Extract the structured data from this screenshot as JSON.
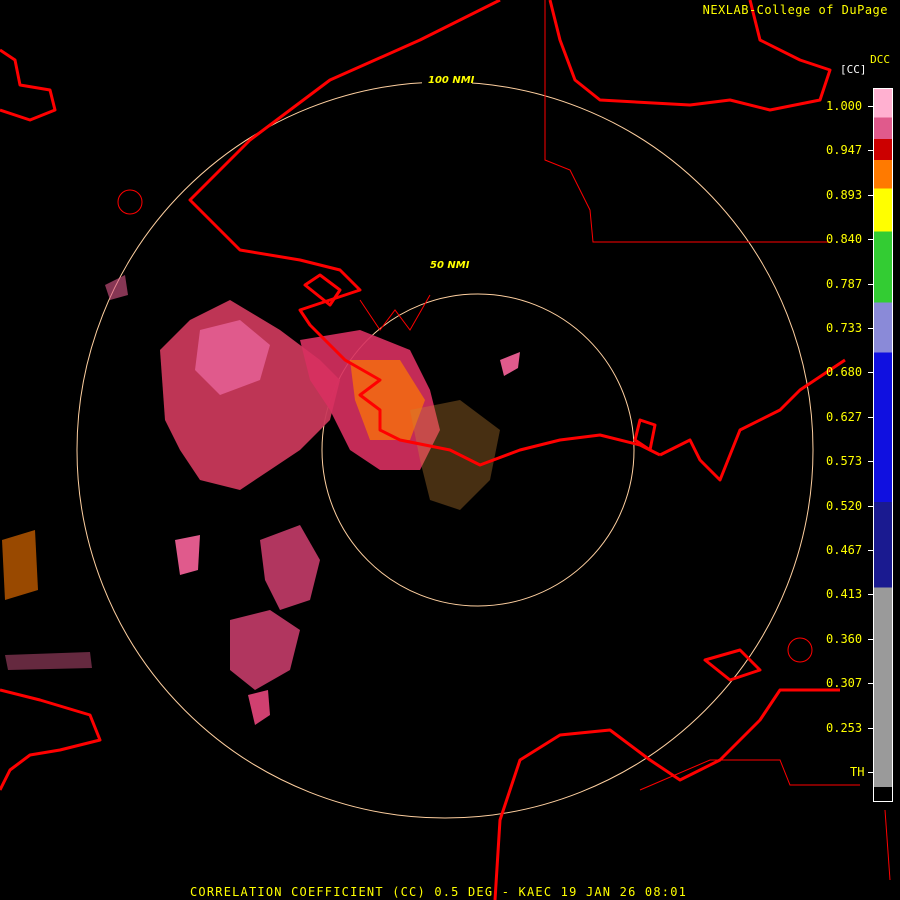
{
  "header": {
    "credit": "NEXLAB-College of DuPage",
    "product_code": "DCC",
    "unit": "[CC]"
  },
  "rings": [
    {
      "label": "100 NMI"
    },
    {
      "label": "50 NMI"
    }
  ],
  "scale": {
    "labels": [
      "1.000",
      "0.947",
      "0.893",
      "0.840",
      "0.787",
      "0.733",
      "0.680",
      "0.627",
      "0.573",
      "0.520",
      "0.467",
      "0.413",
      "0.360",
      "0.307",
      "0.253",
      "TH"
    ],
    "colors": {
      "top": "#ffb0d0",
      "pink": "#e05a8c",
      "red": "#cc0000",
      "orange": "#ff7a00",
      "yellow": "#ffff00",
      "green": "#33cc33",
      "lightblue": "#8a8ad8",
      "blue": "#1010e0",
      "darkblue": "#1a1a90",
      "gray": "#9a9a9a"
    }
  },
  "colors": {
    "coast": "#ff0000",
    "ring": "#ffd0a0",
    "text": "#ffff00"
  },
  "footer": {
    "title": "CORRELATION COEFFICIENT (CC) 0.5 DEG - KAEC 19 JAN 26 08:01"
  }
}
